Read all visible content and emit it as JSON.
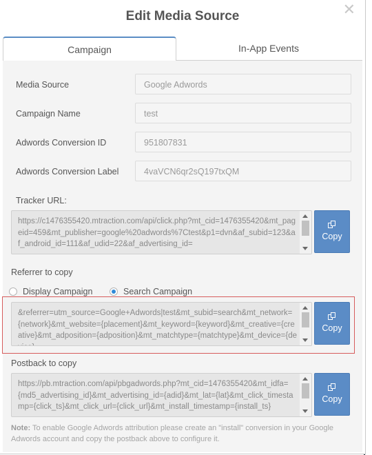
{
  "dialog": {
    "title": "Edit Media Source",
    "close_glyph": "✕"
  },
  "tabs": [
    {
      "label": "Campaign",
      "active": true
    },
    {
      "label": "In-App Events",
      "active": false
    }
  ],
  "fields": [
    {
      "label": "Media Source",
      "value": "Google Adwords"
    },
    {
      "label": "Campaign Name",
      "value": "test"
    },
    {
      "label": "Adwords Conversion ID",
      "value": "951807831"
    },
    {
      "label": "Adwords Conversion Label",
      "value": "4vaVCN6qr2sQ197txQM"
    }
  ],
  "tracker": {
    "label": "Tracker URL:",
    "text": "https://c1476355420.mtraction.com/api/click.php?mt_cid=1476355420&mt_pageid=459&mt_publisher=google%20adwords%7Ctest&p1=dvn&af_subid=123&af_android_id=111&af_udid=22&af_advertising_id=",
    "copy_label": "Copy"
  },
  "referrer": {
    "label": "Referrer to copy",
    "options": [
      {
        "label": "Display Campaign",
        "selected": false
      },
      {
        "label": "Search Campaign",
        "selected": true
      }
    ],
    "text": "&referrer=utm_source=Google+Adwords|test&mt_subid=search&mt_network={network}&mt_website={placement}&mt_keyword={keyword}&mt_creative={creative}&mt_adposition={adposition}&mt_matchtype={matchtype}&mt_device={device}",
    "copy_label": "Copy"
  },
  "postback": {
    "label": "Postback to copy",
    "text": "https://pb.mtraction.com/api/pbgadwords.php?mt_cid=1476355420&mt_idfa={md5_advertising_id}&mt_advertising_id={adid}&mt_lat={lat}&mt_click_timestamp={click_ts}&mt_click_url={click_url}&mt_install_timestamp={install_ts}",
    "copy_label": "Copy"
  },
  "note": {
    "prefix": "Note:",
    "text": " To enable Google Adwords attribution please create an \"install\" conversion in your Google Adwords account and copy the postback above to configure it."
  },
  "colors": {
    "accent": "#5b8cc6",
    "highlight_border": "#d65b5b",
    "radio_selected": "#2f8ad8"
  }
}
